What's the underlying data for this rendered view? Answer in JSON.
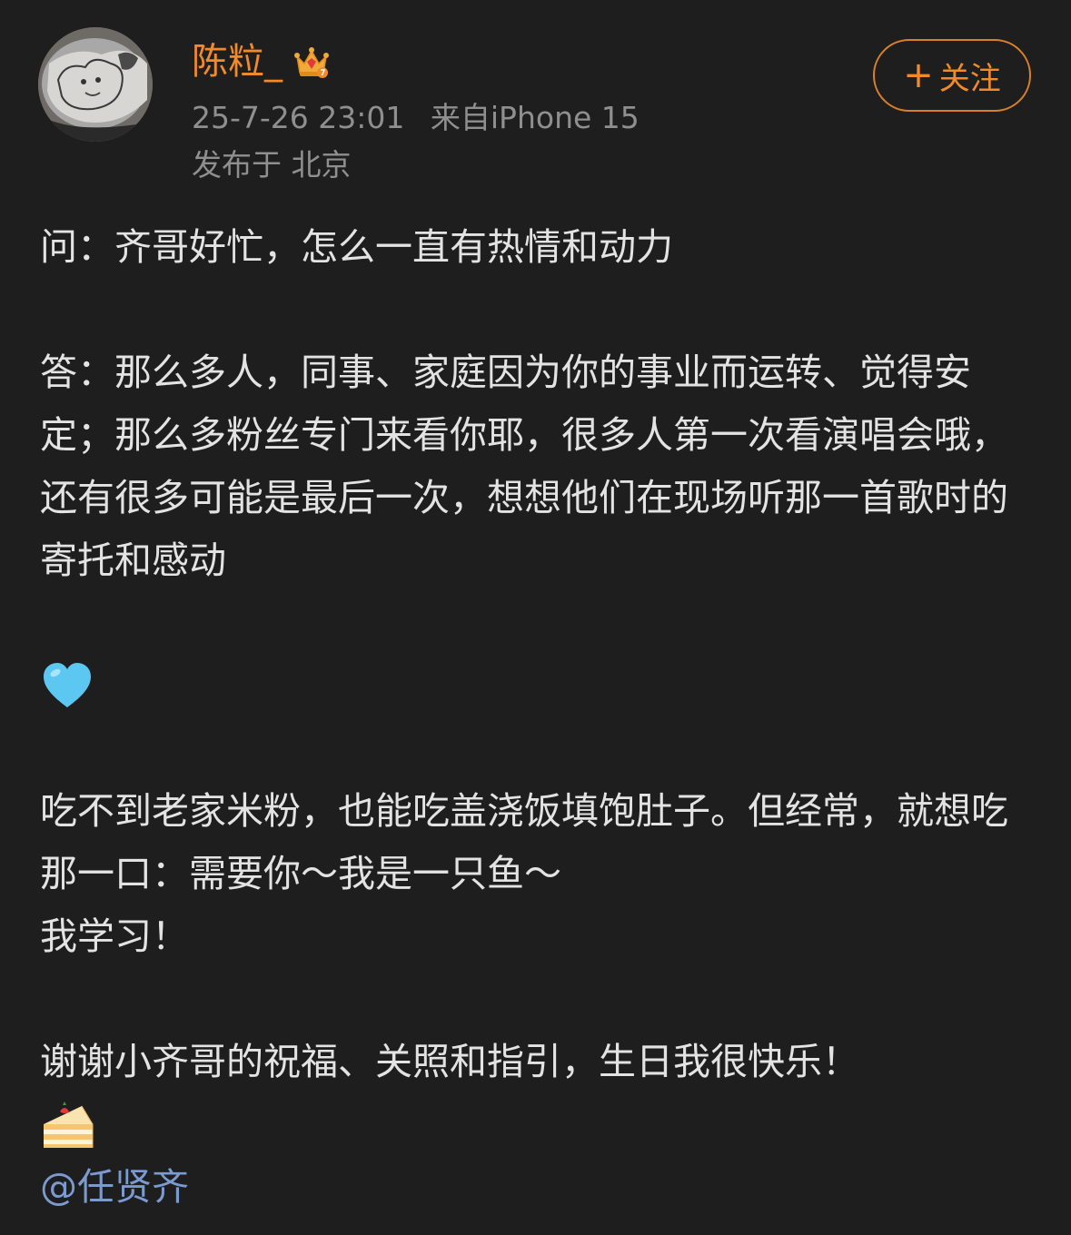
{
  "user": {
    "name": "陈粒_",
    "badge_icon": "crown-icon",
    "timestamp": "25-7-26 23:01",
    "source": "来自iPhone 15",
    "location": "发布于 北京"
  },
  "follow_button": {
    "icon": "plus-icon",
    "label": "关注"
  },
  "post": {
    "question": "问：齐哥好忙，怎么一直有热情和动力",
    "answer": "答：那么多人，同事、家庭因为你的事业而运转、觉得安定；那么多粉丝专门来看你耶，很多人第一次看演唱会哦，还有很多可能是最后一次，想想他们在现场听那一首歌时的寄托和感动",
    "heart_emoji": "light-blue-heart-icon",
    "line1": "吃不到老家米粉，也能吃盖浇饭填饱肚子。但经常，就想吃那一口：需要你～我是一只鱼～",
    "line2": "我学习！",
    "thanks": "谢谢小齐哥的祝福、关照和指引，生日我很快乐！",
    "cake_emoji": "shortcake-icon",
    "mention": "@任贤齐"
  },
  "colors": {
    "background": "#1e1e1e",
    "accent": "#f08a2a",
    "meta_text": "#8f8f8f",
    "mention": "#7b9ad0"
  }
}
